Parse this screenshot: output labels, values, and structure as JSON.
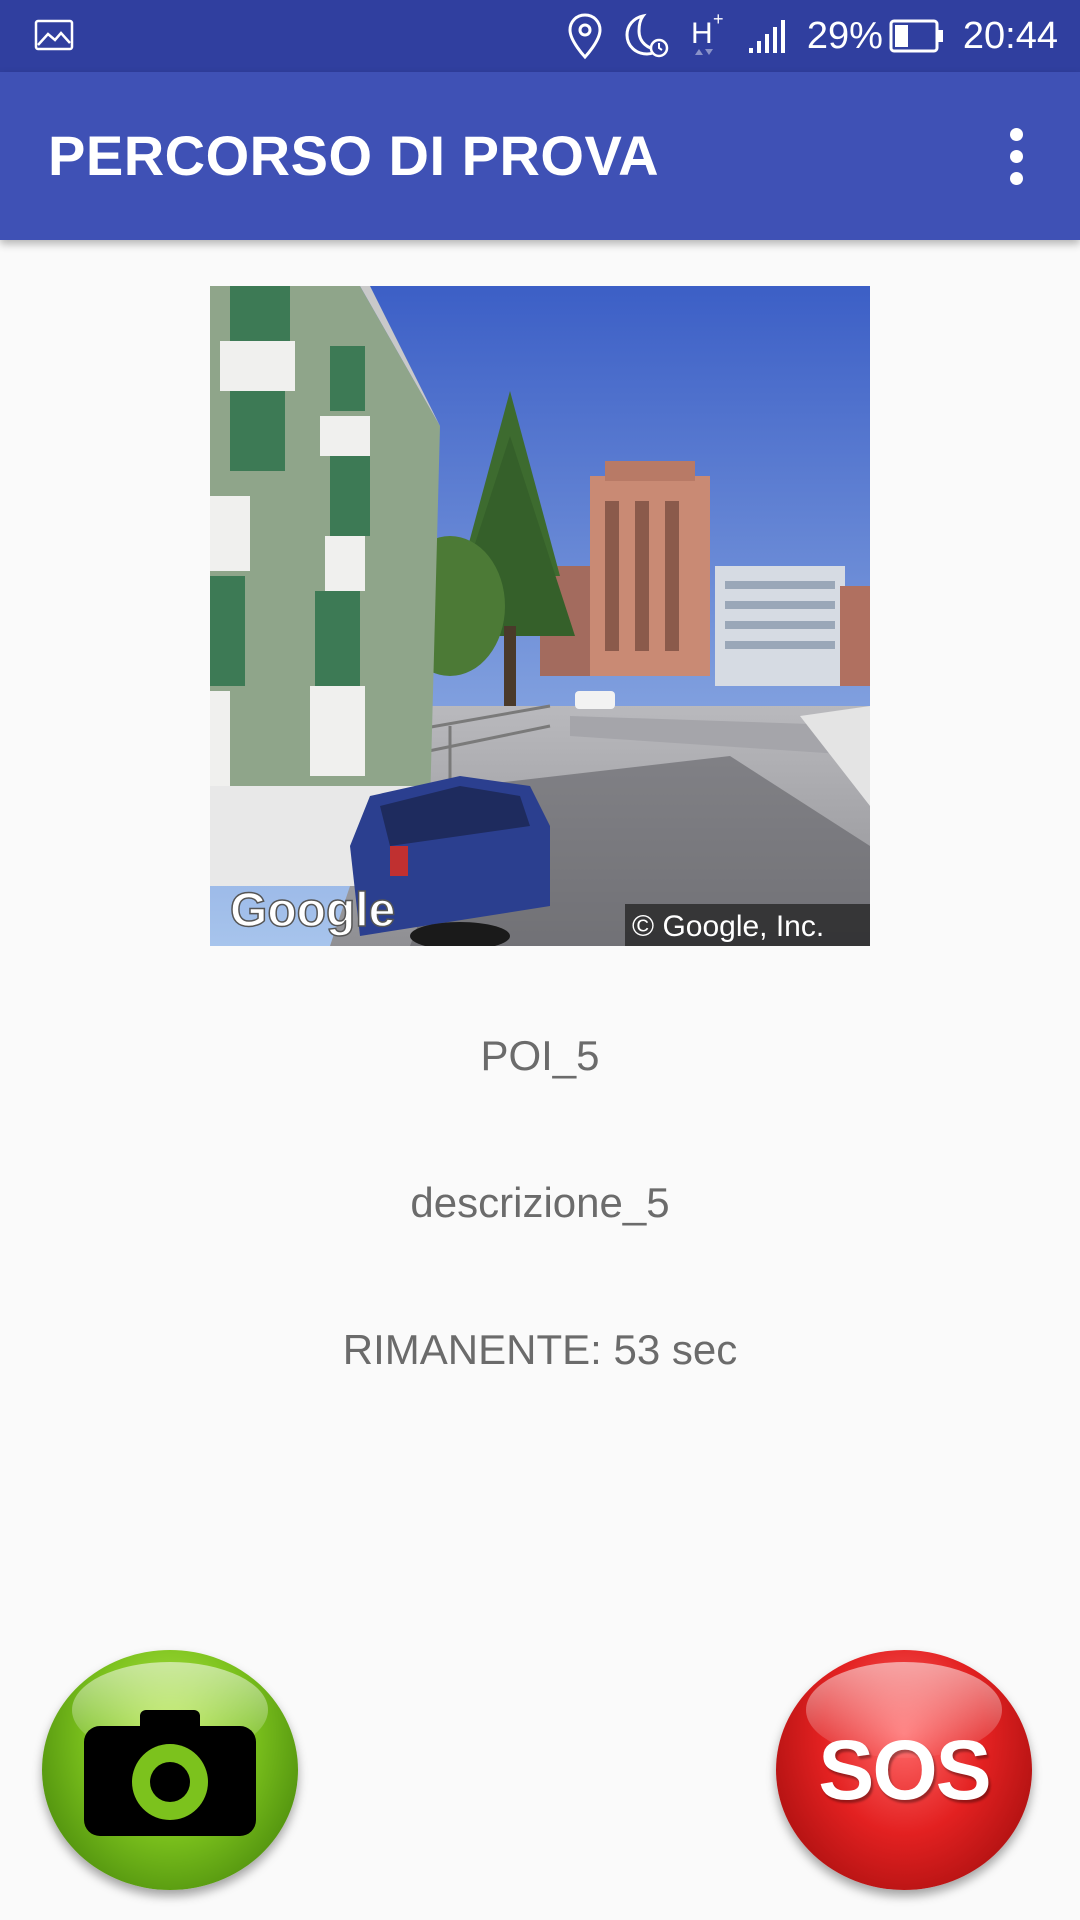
{
  "status_bar": {
    "battery_percent": "29%",
    "time": "20:44",
    "network_type": "H",
    "icons": [
      "gallery-notification-icon",
      "location-icon",
      "night-mode-alarm-icon",
      "network-h-plus-icon",
      "signal-icon",
      "battery-icon"
    ]
  },
  "app_bar": {
    "title": "PERCORSO DI PROVA",
    "menu_icon": "overflow-menu-icon"
  },
  "poi": {
    "image": {
      "watermark": "Google",
      "copyright": "© Google, Inc."
    },
    "name": "POI_5",
    "description": "descrizione_5",
    "remaining": "RIMANENTE: 53 sec"
  },
  "actions": {
    "camera_icon": "camera-icon",
    "sos_label": "SOS"
  },
  "colors": {
    "status_bar": "#303f9f",
    "app_bar": "#3f51b5",
    "background": "#fafafa",
    "text": "#6b6b6b",
    "camera_button": "#7cc21d",
    "sos_button": "#e32121"
  }
}
